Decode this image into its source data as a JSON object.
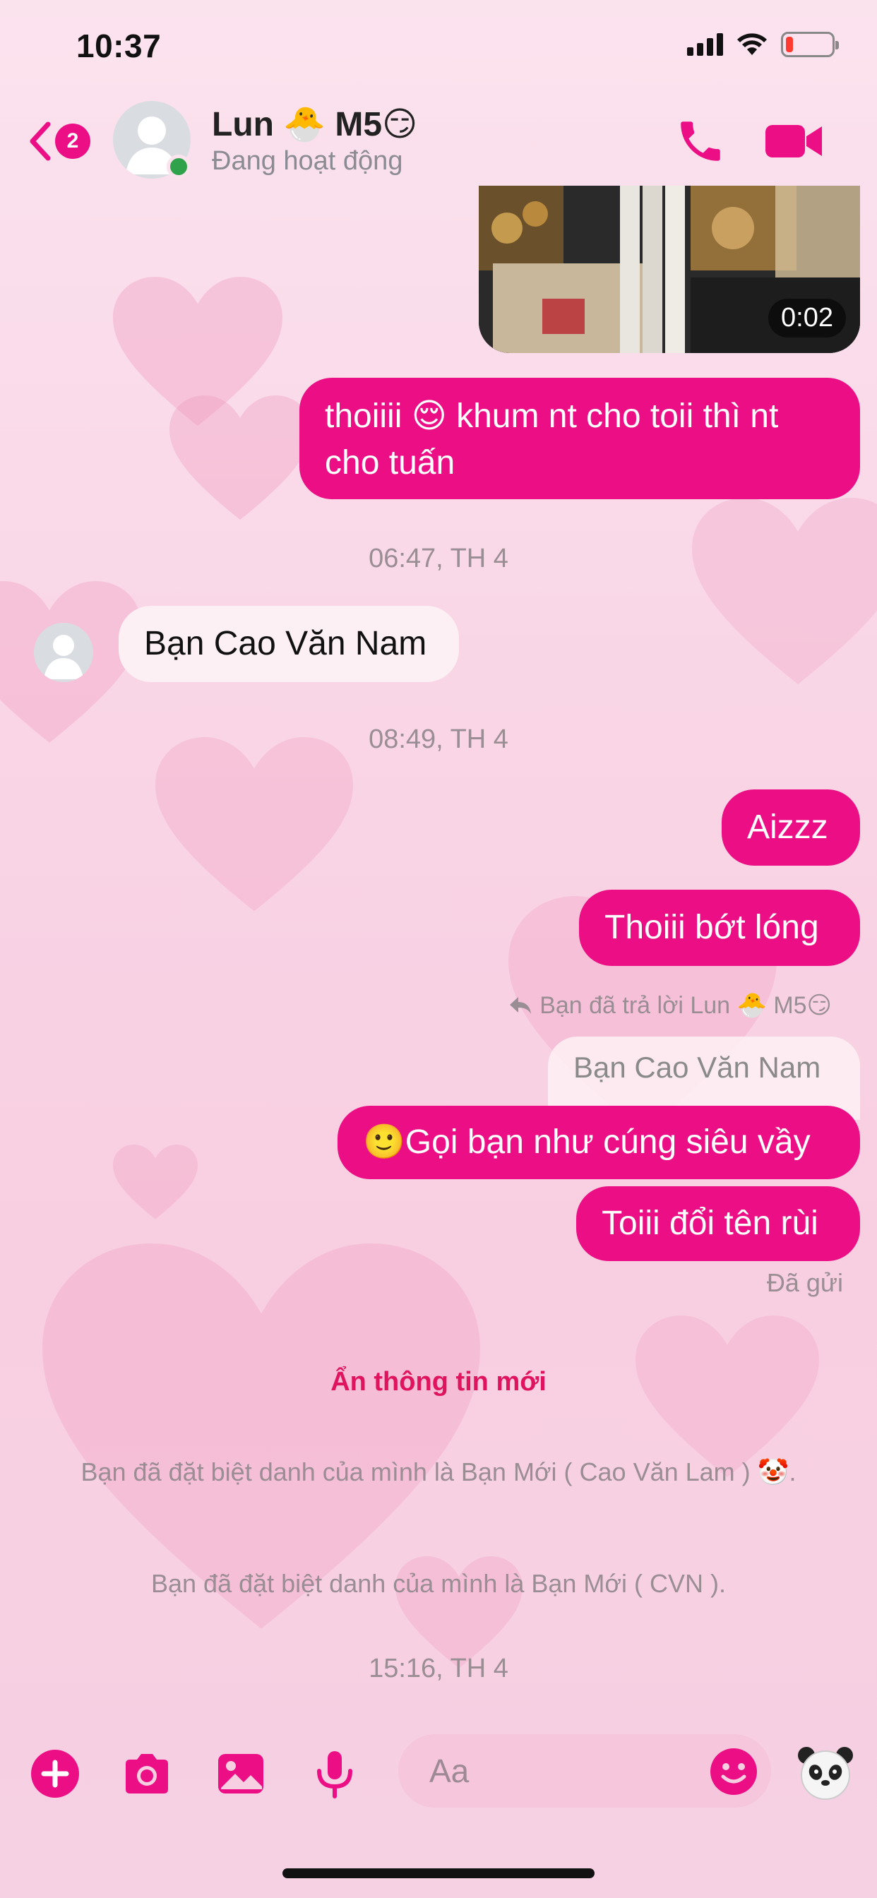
{
  "status_bar": {
    "time": "10:37",
    "battery_level": 0.15,
    "battery_color": "#ff3b30"
  },
  "header": {
    "back_icon": "chevron-left-icon",
    "unread_count": "2",
    "contact_name": "Lun 🐣 M5😏",
    "contact_status": "Đang hoạt động",
    "call_icon": "phone-icon",
    "video_icon": "video-camera-icon"
  },
  "messages": {
    "video_duration": "0:02",
    "m1": "thoiiii 😌 khum nt cho toii thì nt cho tuấn",
    "time1": "06:47, TH 4",
    "m2": "Bạn Cao Văn Nam",
    "time2": "08:49, TH 4",
    "m3": "Aizzz",
    "m4": "Thoiii bớt lóng",
    "reply_note": "Bạn đã trả lời Lun 🐣 M5😏",
    "quoted": "Bạn Cao Văn Nam",
    "m5": "🙂Gọi bạn như cúng siêu vầy",
    "m6": "Toiii đổi tên rùi",
    "sent_status": "Đã gửi"
  },
  "system": {
    "hide_info": "Ẩn thông tin mới",
    "msg1": "Bạn đã đặt biệt danh của mình là Bạn Mới ( Cao Văn Lam ) 🤡.",
    "msg2": "Bạn đã đặt biệt danh của mình là Bạn Mới ( CVN ).",
    "time3": "15:16, TH 4"
  },
  "composer": {
    "placeholder": "Aa",
    "icons": [
      "plus-icon",
      "camera-icon",
      "image-icon",
      "microphone-icon",
      "emoji-icon",
      "panda-icon"
    ]
  },
  "colors": {
    "accent": "#ec0e85",
    "online": "#31a24c"
  }
}
